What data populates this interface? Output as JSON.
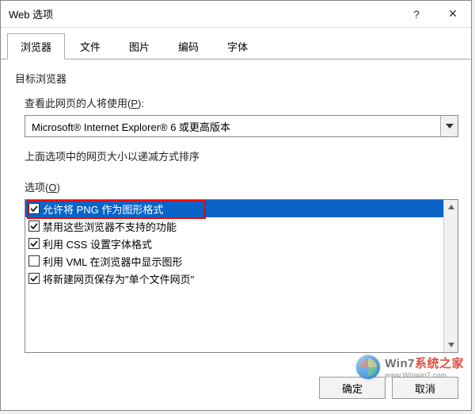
{
  "titlebar": {
    "title": "Web 选项",
    "help": "?",
    "close": "✕"
  },
  "tabs": [
    {
      "label": "浏览器",
      "active": true
    },
    {
      "label": "文件",
      "active": false
    },
    {
      "label": "图片",
      "active": false
    },
    {
      "label": "编码",
      "active": false
    },
    {
      "label": "字体",
      "active": false
    }
  ],
  "section": {
    "target_browser_heading": "目标浏览器",
    "viewer_label_pre": "查看此网页的人将使用(",
    "viewer_label_u": "P",
    "viewer_label_post": "):",
    "browser_value": "Microsoft® Internet Explorer® 6 或更高版本",
    "sort_info": "上面选项中的网页大小以递减方式排序",
    "options_label_pre": "选项(",
    "options_label_u": "O",
    "options_label_post": ")"
  },
  "options": [
    {
      "checked": true,
      "label": "允许将 PNG 作为图形格式",
      "selected": true,
      "highlight": true
    },
    {
      "checked": true,
      "label": "禁用这些浏览器不支持的功能",
      "selected": false
    },
    {
      "checked": true,
      "label": "利用 CSS 设置字体格式",
      "selected": false
    },
    {
      "checked": false,
      "label": "利用 VML 在浏览器中显示图形",
      "selected": false
    },
    {
      "checked": true,
      "label": "将新建网页保存为\"单个文件网页\"",
      "selected": false
    }
  ],
  "buttons": {
    "ok": "确定",
    "cancel": "取消"
  },
  "watermark": {
    "brand_a": "Win7",
    "brand_b": "系统之家",
    "url": "www.Winwin7.com"
  }
}
